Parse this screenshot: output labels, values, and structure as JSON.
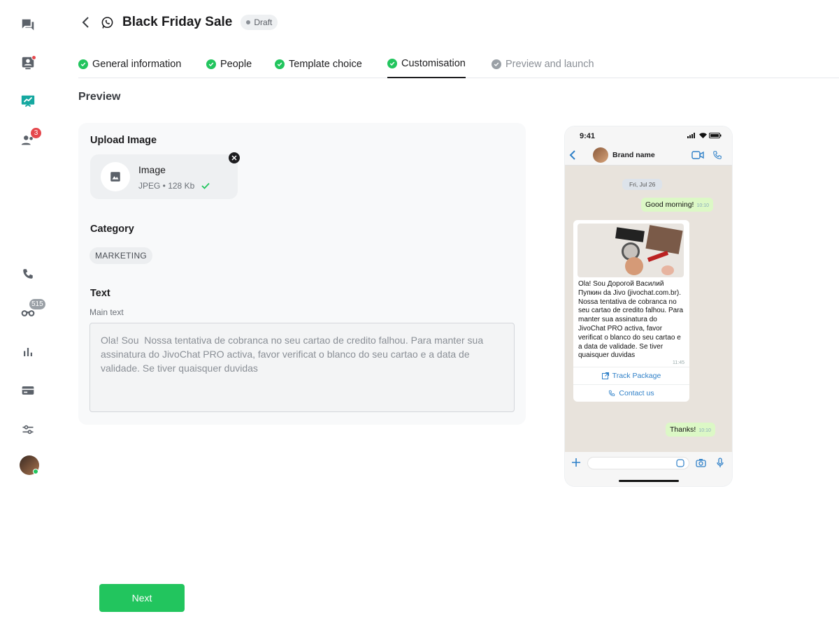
{
  "nav_rail": {
    "team_badge": "3",
    "chat_badge": "515"
  },
  "header": {
    "title": "Black Friday Sale",
    "status": "Draft"
  },
  "tabs": [
    {
      "label": "General information",
      "state": "done"
    },
    {
      "label": "People",
      "state": "done"
    },
    {
      "label": "Template choice",
      "state": "done"
    },
    {
      "label": "Customisation",
      "state": "active"
    },
    {
      "label": "Preview and launch",
      "state": "pending"
    }
  ],
  "section": {
    "title": "Preview"
  },
  "form": {
    "upload": {
      "label": "Upload Image",
      "file_name": "Image",
      "file_meta": "JPEG • 128 Kb"
    },
    "category": {
      "label": "Category",
      "value": "MARKETING"
    },
    "text": {
      "label": "Text",
      "sub_label": "Main text",
      "value": "Ola! Sou  Nossa tentativa de cobranca no seu cartao de credito falhou. Para manter sua assinatura do JivoChat PRO activa, favor verificat o blanco do seu cartao e a data de validade. Se tiver quaisquer duvidas"
    }
  },
  "phone": {
    "time": "9:41",
    "brand_name": "Brand name",
    "date": "Fri, Jul 26",
    "messages": {
      "greeting": "Good morning!",
      "greeting_time": "10:10",
      "template_text": "Ola! Sou Дорогой Василий Пупкин da Jivo (jivochat.com.br). Nossa tentativa de cobranca no seu cartao de credito falhou. Para manter sua assinatura do JivoChat PRO activa, favor verificat o blanco do seu cartao e a data de validade. Se tiver quaisquer duvidas",
      "template_time": "11:45",
      "button_1": "Track Package",
      "button_2": "Contact us",
      "reply": "Thanks!",
      "reply_time": "10:10"
    }
  },
  "footer": {
    "next_label": "Next"
  },
  "colors": {
    "accent_green": "#22c55e",
    "badge_red": "#e5484d",
    "link_blue": "#2f80c8",
    "bubble_out": "#dcf8c6"
  }
}
